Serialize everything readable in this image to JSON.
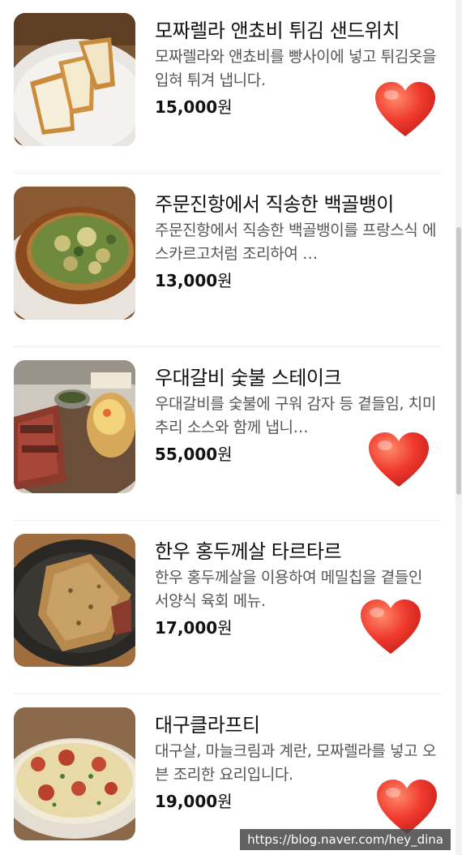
{
  "menu": {
    "currency_suffix": "원",
    "items": [
      {
        "name": "모짜렐라 앤쵸비 튀김 샌드위치",
        "description": "모짜렐라와 앤쵸비를 빵사이에 넣고 튀김옷을 입혀 튀겨 냅니다.",
        "price": "15,000",
        "liked": true,
        "image_label": "fried-sandwich"
      },
      {
        "name": "주문진항에서 직송한 백골뱅이",
        "description": "주문진항에서 직송한 백골뱅이를 프랑스식 에스카르고처럼 조리하여 …",
        "price": "13,000",
        "liked": false,
        "image_label": "baked-whelk"
      },
      {
        "name": "우대갈비 숯불 스테이크",
        "description": "우대갈비를 숯불에 구워 감자 등 곁들임, 치미추리 소스와 함께 냅니…",
        "price": "55,000",
        "liked": true,
        "image_label": "rib-steak"
      },
      {
        "name": "한우 홍두께살 타르타르",
        "description": "한우 홍두께살을 이용하여 메밀칩을 곁들인 서양식 육회 메뉴.",
        "price": "17,000",
        "liked": true,
        "image_label": "beef-tartare"
      },
      {
        "name": "대구클라프티",
        "description": "대구살, 마늘크림과 계란, 모짜렐라를 넣고 오븐 조리한 요리입니다.",
        "price": "19,000",
        "liked": true,
        "image_label": "cod-clafoutis"
      }
    ]
  },
  "watermark": "https://blog.naver.com/hey_dina",
  "colors": {
    "heart": "#f03a2e",
    "text": "#111111",
    "desc": "#555555"
  }
}
